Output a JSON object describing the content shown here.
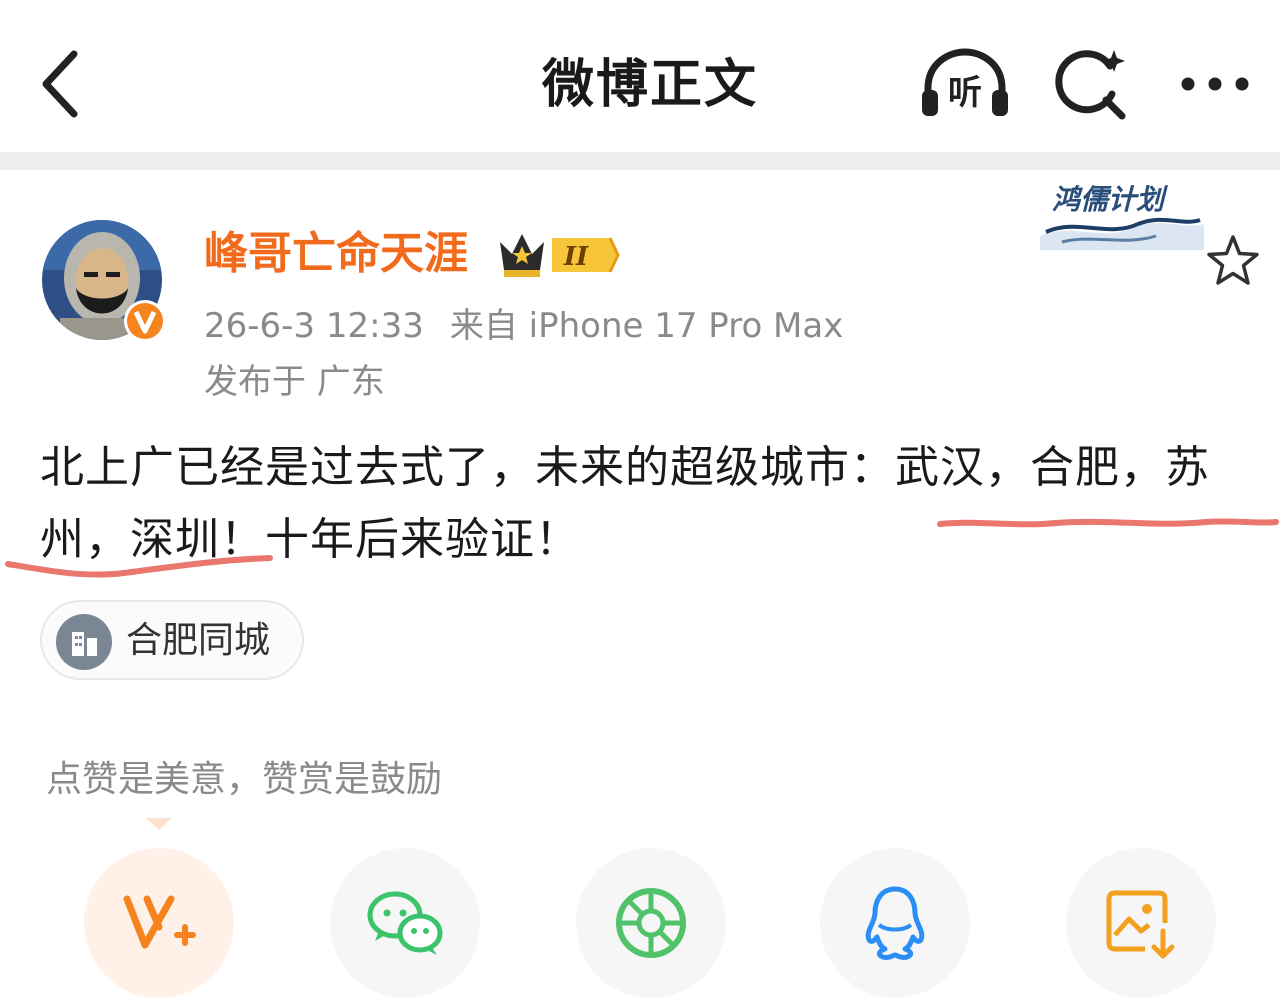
{
  "header": {
    "title": "微博正文",
    "listen_label": "听"
  },
  "post": {
    "author": {
      "name": "峰哥亡命天涯",
      "level": "II"
    },
    "meta": {
      "time": "26-6-3 12:33",
      "source": "来自 iPhone 17 Pro Max",
      "location": "发布于 广东"
    },
    "campaign_badge": "鸿儒计划",
    "text": {
      "line1": "北上广已经是过去式了，未来的超级城市：武汉，合肥，苏",
      "line2": "州，深圳！十年后来验证！"
    },
    "topic": "合肥同城"
  },
  "reward_hint": "点赞是美意，赞赏是鼓励",
  "colors": {
    "username": "#f26b1d",
    "vip_orange": "#f5841f",
    "wechat_green": "#3bc46b",
    "moments_green": "#50c36a",
    "qq_blue": "#2a8ef5",
    "save_orange": "#f2a020",
    "underline_red": "#e4554a"
  }
}
